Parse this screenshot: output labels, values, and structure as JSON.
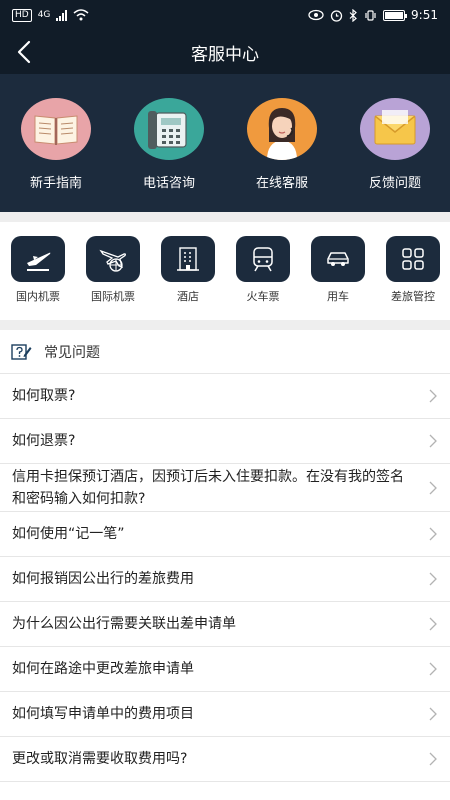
{
  "status_bar": {
    "network_tag": "HD",
    "network_type": "4G",
    "time": "9:51"
  },
  "nav": {
    "title": "客服中心",
    "back_icon": "chevron-left-icon"
  },
  "hero_items": [
    {
      "label": "新手指南",
      "icon": "book-icon",
      "color": "#e8a4a8"
    },
    {
      "label": "电话咨询",
      "icon": "telephone-icon",
      "color": "#3aa79a"
    },
    {
      "label": "在线客服",
      "icon": "agent-avatar-icon",
      "color": "#f09a3e"
    },
    {
      "label": "反馈问题",
      "icon": "envelope-icon",
      "color": "#b9a3d6"
    }
  ],
  "services": [
    {
      "label": "国内机票",
      "icon": "airplane-icon"
    },
    {
      "label": "国际机票",
      "icon": "international-flight-icon"
    },
    {
      "label": "酒店",
      "icon": "hotel-building-icon"
    },
    {
      "label": "火车票",
      "icon": "train-icon"
    },
    {
      "label": "用车",
      "icon": "car-icon"
    },
    {
      "label": "差旅管控",
      "icon": "grid-icon"
    }
  ],
  "faq": {
    "header": "常见问题",
    "header_icon": "question-edit-icon",
    "items": [
      {
        "q": "如何取票?"
      },
      {
        "q": "如何退票?"
      },
      {
        "q": "信用卡担保预订酒店，因预订后未入住要扣款。在没有我的签名和密码输入如何扣款?"
      },
      {
        "q": "如何使用“记一笔”"
      },
      {
        "q": "如何报销因公出行的差旅费用"
      },
      {
        "q": "为什么因公出行需要关联出差申请单"
      },
      {
        "q": "如何在路途中更改差旅申请单"
      },
      {
        "q": "如何填写申请单中的费用项目"
      },
      {
        "q": "更改或取消需要收取费用吗?"
      }
    ]
  },
  "colors": {
    "header_bg": "#111c28",
    "hero_bg": "#1c2b3d",
    "icon_tile_bg": "#1c2b3d",
    "divider": "#e6e6e6"
  }
}
